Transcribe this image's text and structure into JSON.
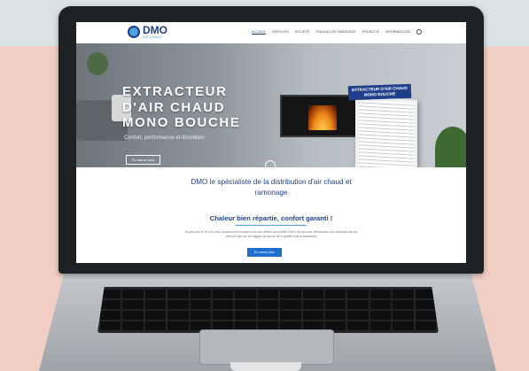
{
  "logo": {
    "main": "DMO",
    "sub": "AIR CHAUD"
  },
  "nav": {
    "items": [
      "ACCUEIL",
      "SERVICES",
      "SOCIÉTÉ",
      "TRAVAUX DE RAMONAGE",
      "PRODUITS",
      "INFORMATIONS"
    ]
  },
  "hero": {
    "title_lines": [
      "EXTRACTEUR",
      "D'AIR CHAUD",
      "MONO BOUCHE"
    ],
    "subtitle": "Confort, performance et discrétion",
    "button_label": "En savoir plus",
    "badge_lines": [
      "EXTRACTEUR D'AIR CHAUD",
      "MONO BOUCHE"
    ]
  },
  "content": {
    "headline": "DMO le spécialiste de la distribution d'air chaud et ramonage",
    "tagline": "Chaleur bien répartie, confort garanti !",
    "description": "Depuis plus de 30 ans, nous à passion des hommes pour nos métiers qui permet à DMO de répondre efficacement aux demandes de ses clients et ainsi de se engager au service de la qualité et de la satisfaction",
    "cta_label": "En savoir plus"
  },
  "colors": {
    "brand": "#1f3f8a",
    "accent": "#4aa3df",
    "button": "#1f6fd1"
  }
}
